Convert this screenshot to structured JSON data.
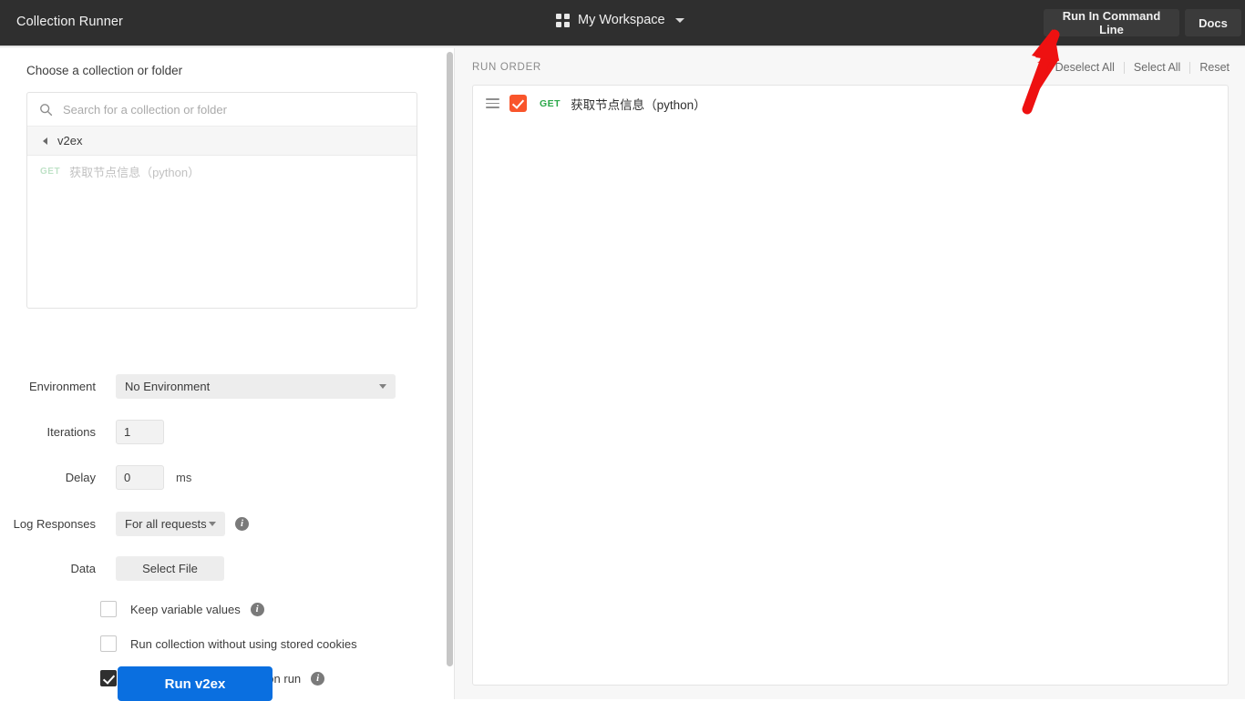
{
  "topbar": {
    "app_title": "Collection Runner",
    "grid_icon": "grid-icon",
    "workspace_label": "My Workspace",
    "workspace_caret": "chevron-down-icon",
    "run_command_line_label": "Run In Command Line",
    "docs_label": "Docs",
    "bg_color": "#2f2f2f",
    "button_bg_color": "#3b3b3b"
  },
  "left_panel": {
    "caption": "Choose a collection or folder",
    "search": {
      "icon": "search-icon",
      "placeholder": "Search for a collection or folder",
      "value": ""
    },
    "breadcrumb": {
      "back_icon": "chevron-left-icon",
      "label": "v2ex"
    },
    "ghost_request": {
      "method": "GET",
      "name": "获取节点信息（python）"
    },
    "environment": {
      "label": "Environment",
      "value": "No Environment",
      "caret": "chevron-down-icon"
    },
    "iterations": {
      "label": "Iterations",
      "value": "1"
    },
    "delay": {
      "label": "Delay",
      "value": "0",
      "unit": "ms"
    },
    "log_responses": {
      "label": "Log Responses",
      "value": "For all requests",
      "caret": "chevron-down-icon",
      "info": "i"
    },
    "data": {
      "label": "Data",
      "button_label": "Select File"
    },
    "checkboxes": [
      {
        "label": "Keep variable values",
        "checked": false,
        "has_info": true,
        "info": "i"
      },
      {
        "label": "Run collection without using stored cookies",
        "checked": false,
        "has_info": false,
        "info": ""
      },
      {
        "label": "Save cookies after collection run",
        "checked": true,
        "has_info": true,
        "info": "i"
      }
    ],
    "run_button": {
      "label": "Run v2ex",
      "color": "#0a6fe0"
    }
  },
  "right_panel": {
    "run_order_label": "RUN ORDER",
    "actions": {
      "deselect_all": "Deselect All",
      "select_all": "Select All",
      "reset": "Reset"
    },
    "requests": [
      {
        "drag_handle": "drag-handle-icon",
        "checked": true,
        "checkbox_color": "#f9552b",
        "method": "GET",
        "method_color": "#2ba84a",
        "name": "获取节点信息（python）"
      }
    ]
  },
  "annotation": {
    "arrow_color": "#ee1111",
    "points_at": "Run In Command Line"
  }
}
